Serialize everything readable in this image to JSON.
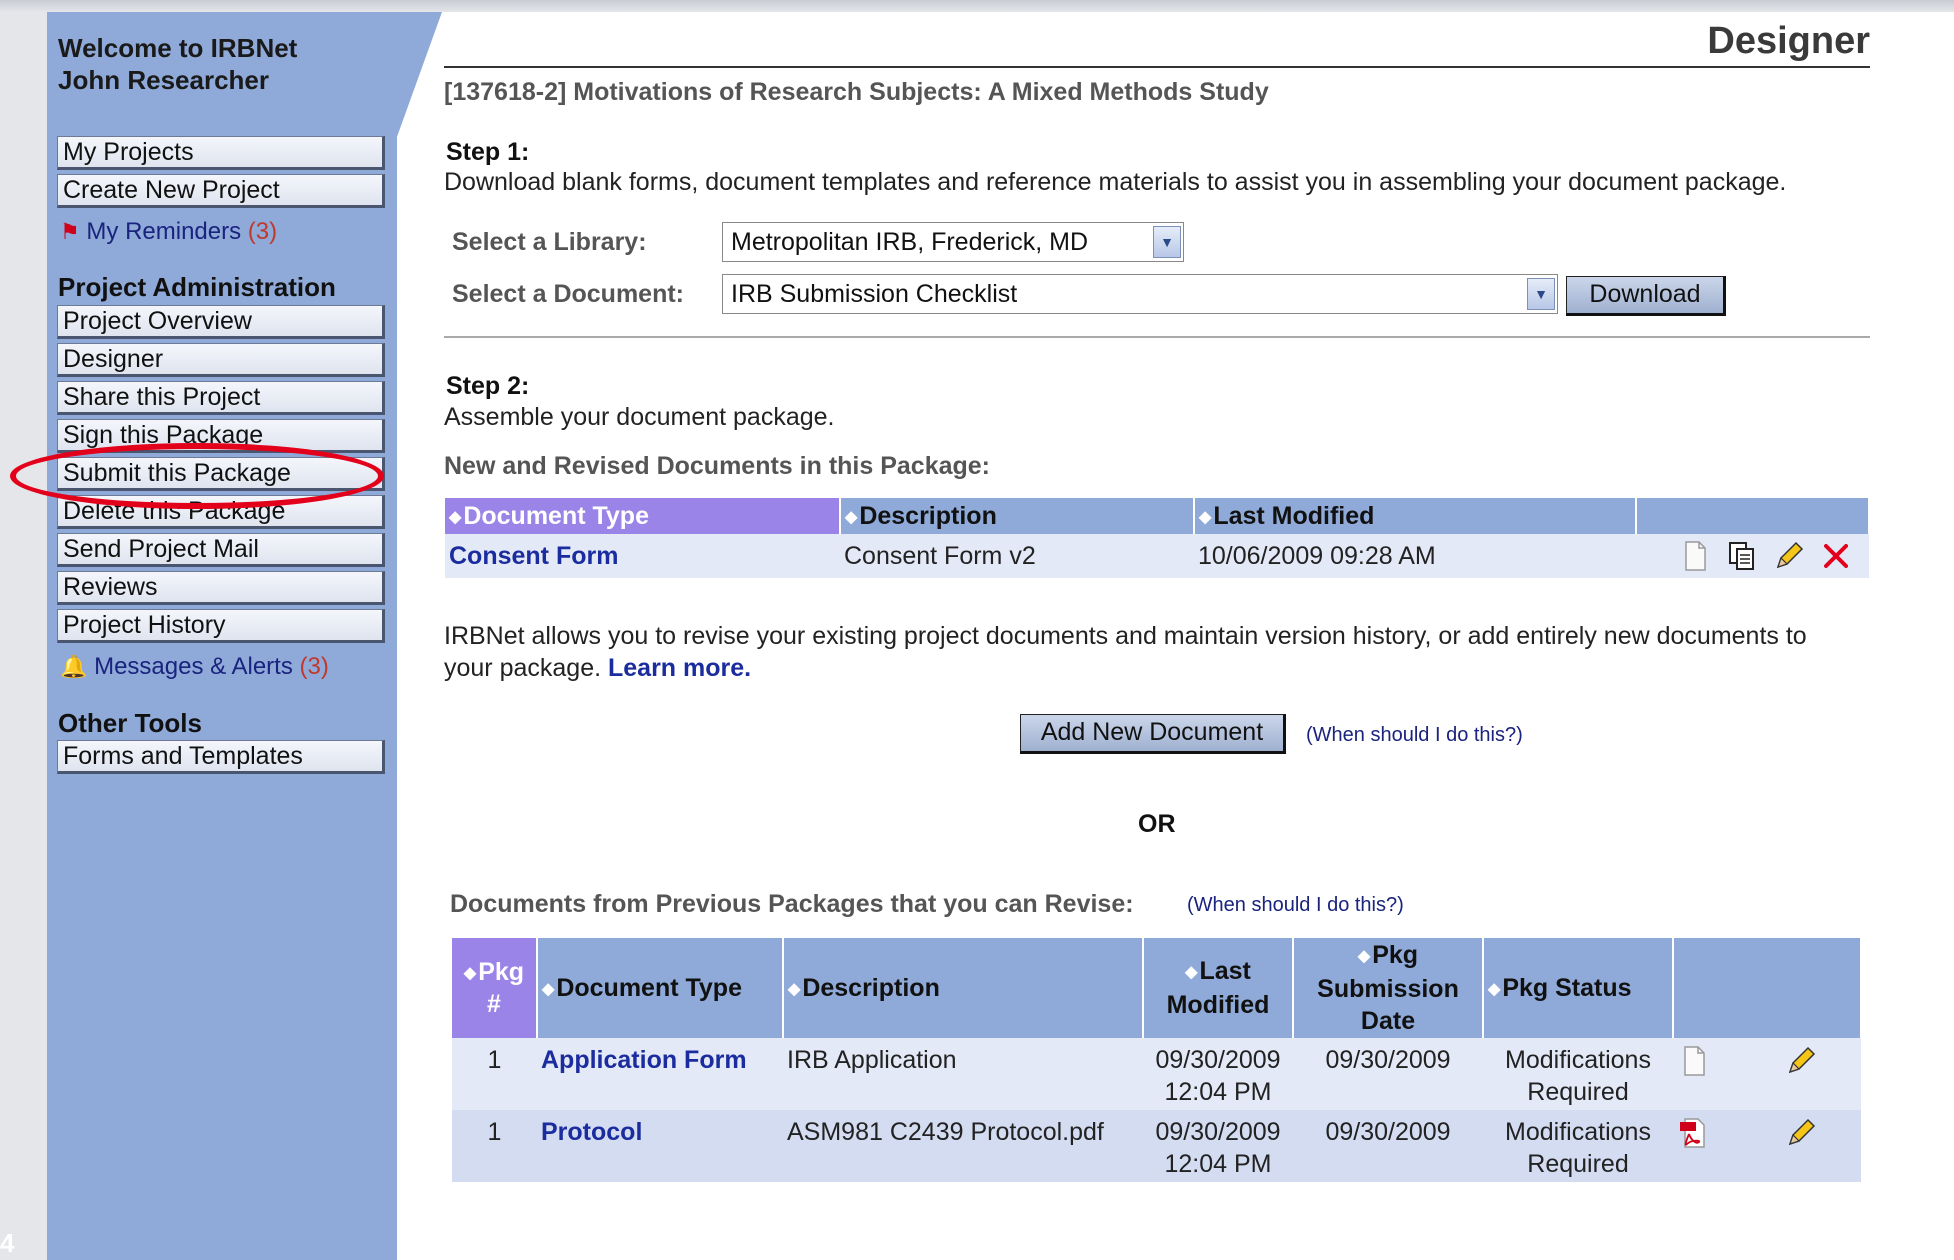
{
  "sidebar": {
    "welcome": "Welcome to IRBNet",
    "user": "John Researcher",
    "items_top": [
      {
        "label": "My Projects"
      },
      {
        "label": "Create New Project"
      }
    ],
    "reminders": {
      "label": "My Reminders",
      "count": "(3)"
    },
    "admin_header": "Project Administration",
    "admin_items": [
      {
        "label": "Project Overview"
      },
      {
        "label": "Designer"
      },
      {
        "label": "Share this Project"
      },
      {
        "label": "Sign this Package"
      },
      {
        "label": "Submit this Package"
      },
      {
        "label": "Delete this Package"
      },
      {
        "label": "Send Project Mail"
      },
      {
        "label": "Reviews"
      },
      {
        "label": "Project History"
      }
    ],
    "messages": {
      "label": "Messages & Alerts",
      "count": "(3)"
    },
    "tools_header": "Other Tools",
    "tools_items": [
      {
        "label": "Forms and Templates"
      }
    ]
  },
  "page": {
    "title": "Designer",
    "project": "[137618-2] Motivations of Research Subjects: A Mixed Methods Study"
  },
  "step1": {
    "heading": "Step 1:",
    "text": "Download blank forms, document templates and reference materials to assist you in assembling your document package.",
    "library_label": "Select a Library:",
    "library_value": "Metropolitan IRB, Frederick, MD",
    "document_label": "Select a Document:",
    "document_value": "IRB Submission Checklist",
    "download_button": "Download"
  },
  "step2": {
    "heading": "Step 2:",
    "text": "Assemble your document package.",
    "new_docs_label": "New and Revised Documents in this Package:",
    "new_docs_columns": [
      "Document Type",
      "Description",
      "Last Modified"
    ],
    "new_docs_rows": [
      {
        "type": "Consent Form",
        "description": "Consent Form v2",
        "modified": "10/06/2009 09:28 AM"
      }
    ],
    "info_text_1": "IRBNet allows you to revise your existing project documents and maintain version history, or add entirely new documents to",
    "info_text_2": "your package.",
    "learn_more": "Learn more.",
    "add_button": "Add New Document",
    "when_link": "(When should I do this?)",
    "or": "OR",
    "prev_label": "Documents from Previous Packages that you can Revise:",
    "prev_when_link": "(When should I do this?)",
    "prev_columns": {
      "pkg": "Pkg #",
      "type": "Document Type",
      "description": "Description",
      "modified": "Last Modified",
      "submission": "Pkg Submission Date",
      "status": "Pkg Status"
    },
    "prev_rows": [
      {
        "pkg": "1",
        "type": "Application Form",
        "description": "IRB Application",
        "modified_date": "09/30/2009",
        "modified_time": "12:04 PM",
        "submission": "09/30/2009",
        "status_1": "Modifications",
        "status_2": "Required",
        "file_icon": "document-icon"
      },
      {
        "pkg": "1",
        "type": "Protocol",
        "description": "ASM981 C2439 Protocol.pdf",
        "modified_date": "09/30/2009",
        "modified_time": "12:04 PM",
        "submission": "09/30/2009",
        "status_1": "Modifications",
        "status_2": "Required",
        "file_icon": "pdf-icon"
      }
    ]
  },
  "colors": {
    "sidebar": "#8faad8",
    "sorted_header": "#9a84e8",
    "highlight_oval": "#e3001b",
    "link": "#1a2c9e"
  },
  "corner_number": "4"
}
